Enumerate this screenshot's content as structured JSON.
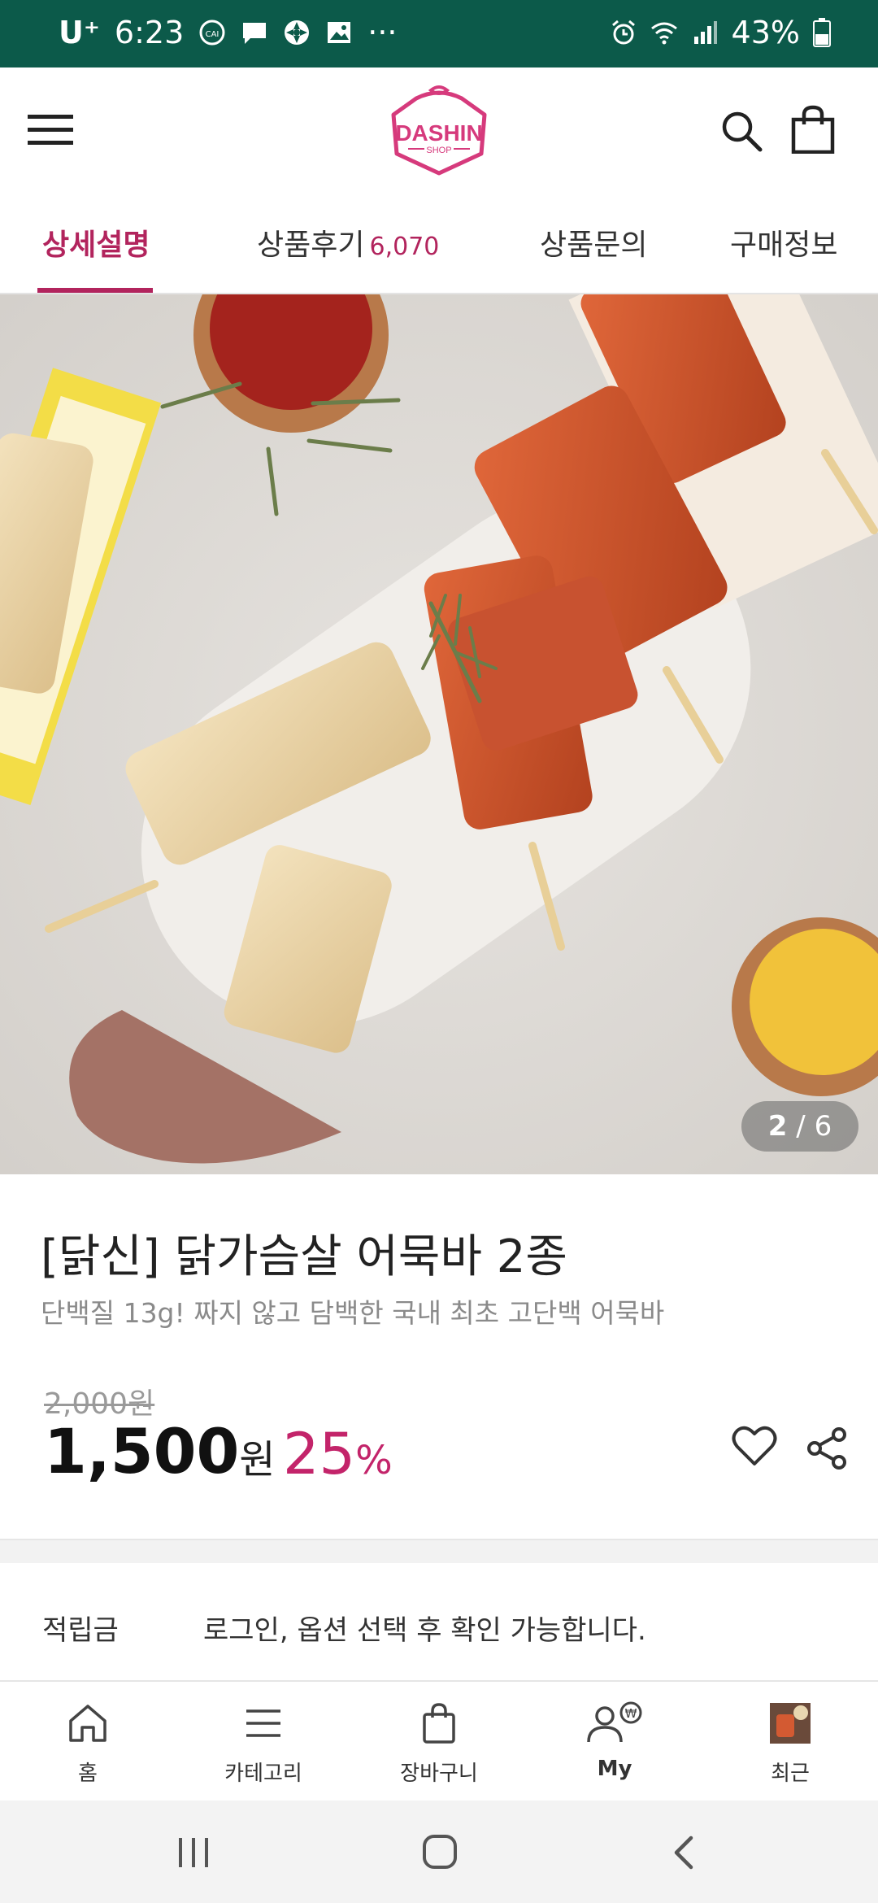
{
  "status_bar": {
    "carrier": "U⁺",
    "time": "6:23",
    "more": "···",
    "battery": "43%"
  },
  "header": {
    "logo_text": "DASHIN",
    "logo_sub": "SHOP"
  },
  "tabs": [
    {
      "label": "상세설명",
      "count": ""
    },
    {
      "label": "상품후기",
      "count": "6,070"
    },
    {
      "label": "상품문의",
      "count": ""
    },
    {
      "label": "구매정보",
      "count": ""
    }
  ],
  "gallery": {
    "current": "2",
    "separator": "/",
    "total": "6"
  },
  "product": {
    "title": "[닭신] 닭가슴살 어묵바 2종",
    "subtitle": "단백질 13g! 짜지 않고 담백한 국내 최초 고단백 어묵바",
    "original_price": "2,000",
    "original_unit": "원",
    "price": "1,500",
    "price_unit": "원",
    "discount": "25",
    "discount_unit": "%"
  },
  "points": {
    "label": "적립금",
    "value": "로그인, 옵션 선택 후 확인 가능합니다."
  },
  "bottom_nav": [
    {
      "label": "홈",
      "icon": "home-icon"
    },
    {
      "label": "카테고리",
      "icon": "menu-icon"
    },
    {
      "label": "장바구니",
      "icon": "bag-icon"
    },
    {
      "label": "My",
      "icon": "user-points-icon"
    },
    {
      "label": "최근",
      "icon": "recent-thumbnail"
    }
  ],
  "colors": {
    "accent": "#b2245d",
    "status_bar": "#0c5a4a",
    "discount": "#c3246a"
  }
}
